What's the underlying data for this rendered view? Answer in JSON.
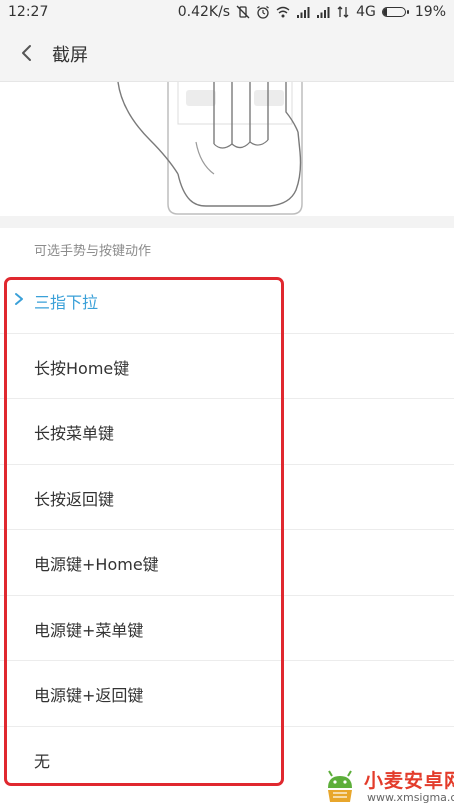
{
  "status_bar": {
    "time": "12:27",
    "speed": "0.42K/s",
    "network": "4G",
    "battery_text": "19%",
    "battery_level": 0.19
  },
  "header": {
    "title": "截屏"
  },
  "section": {
    "label": "可选手势与按键动作"
  },
  "options": [
    {
      "label": "三指下拉",
      "selected": true
    },
    {
      "label": "长按Home键",
      "selected": false
    },
    {
      "label": "长按菜单键",
      "selected": false
    },
    {
      "label": "长按返回键",
      "selected": false
    },
    {
      "label": "电源键+Home键",
      "selected": false
    },
    {
      "label": "电源键+菜单键",
      "selected": false
    },
    {
      "label": "电源键+返回键",
      "selected": false
    },
    {
      "label": "无",
      "selected": false
    }
  ],
  "colors": {
    "accent": "#3aa0d8",
    "highlight": "#e0282f"
  },
  "watermark": {
    "brand": "小麦安卓网",
    "site": "www.xmsigma.com"
  }
}
